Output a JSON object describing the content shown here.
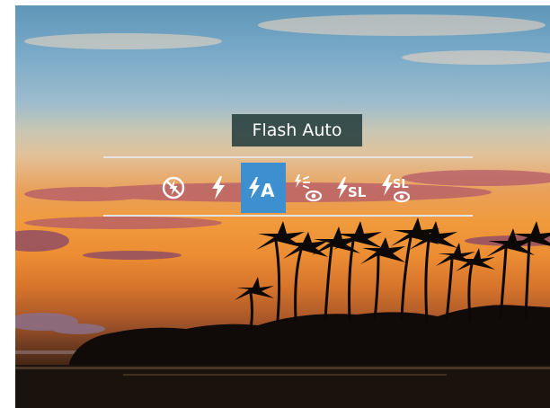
{
  "tooltip": {
    "label": "Flash Auto"
  },
  "flash_modes": [
    {
      "icon": "flash-off-icon",
      "selected": false
    },
    {
      "icon": "flash-on-icon",
      "selected": false
    },
    {
      "icon": "flash-auto-icon",
      "text": "A",
      "selected": true
    },
    {
      "icon": "red-eye-reduction-icon",
      "selected": false
    },
    {
      "icon": "slow-sync-icon",
      "text": "SL",
      "selected": false
    },
    {
      "icon": "slow-sync-red-eye-icon",
      "text": "SL",
      "selected": false
    }
  ],
  "colors": {
    "accent": "#3d8fd0",
    "tooltip_bg": "#213939",
    "icon": "#ffffff"
  }
}
